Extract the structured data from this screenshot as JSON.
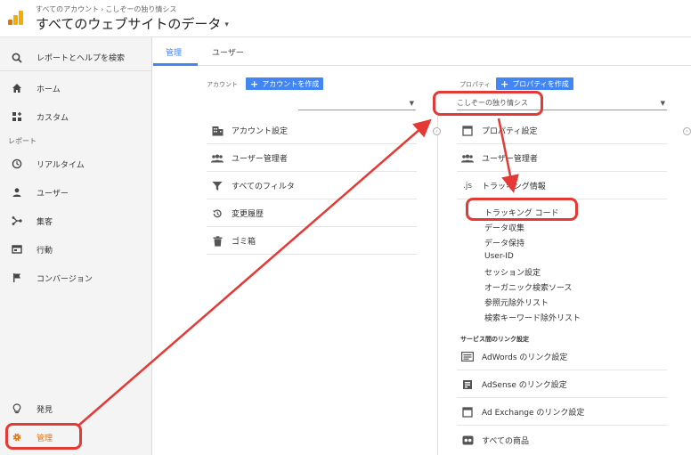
{
  "header": {
    "breadcrumb_account": "すべてのアカウント",
    "breadcrumb_sep": "›",
    "breadcrumb_property": "こしぞーの独り情シス",
    "title": "すべてのウェブサイトのデータ",
    "title_caret": "▾"
  },
  "sidebar": {
    "search": "レポートとヘルプを検索",
    "home": "ホーム",
    "custom": "カスタム",
    "section_reports": "レポート",
    "realtime": "リアルタイム",
    "users": "ユーザー",
    "acquisition": "集客",
    "behavior": "行動",
    "conversions": "コンバージョン",
    "discover": "発見",
    "admin": "管理"
  },
  "tabs": {
    "admin": "管理",
    "user": "ユーザー"
  },
  "account": {
    "label": "アカウント",
    "create_button": "アカウントを作成",
    "items": {
      "settings": "アカウント設定",
      "user_management": "ユーザー管理者",
      "all_filters": "すべてのフィルタ",
      "change_history": "変更履歴",
      "trash": "ゴミ箱"
    }
  },
  "property": {
    "label": "プロパティ",
    "create_button": "プロパティを作成",
    "selected": "こしぞーの独り情シス",
    "items": {
      "settings": "プロパティ設定",
      "user_management": "ユーザー管理者",
      "tracking_info_icon": ".js",
      "tracking_info": "トラッキング情報"
    },
    "tracking_sub": {
      "tracking_code": "トラッキング コード",
      "data_collection": "データ収集",
      "data_retention": "データ保持",
      "user_id": "User-ID",
      "session_settings": "セッション設定",
      "organic_sources": "オーガニック検索ソース",
      "referral_exclusion": "参照元除外リスト",
      "search_term_exclusion": "検索キーワード除外リスト"
    },
    "service_links_heading": "サービス間のリンク設定",
    "service_links": {
      "adwords": "AdWords のリンク設定",
      "adsense": "AdSense のリンク設定",
      "ad_exchange": "Ad Exchange のリンク設定",
      "all_products": "すべての商品"
    }
  },
  "colors": {
    "accent_blue": "#4285f4",
    "admin_orange": "#e8710a",
    "annotation_red": "#e53935"
  }
}
